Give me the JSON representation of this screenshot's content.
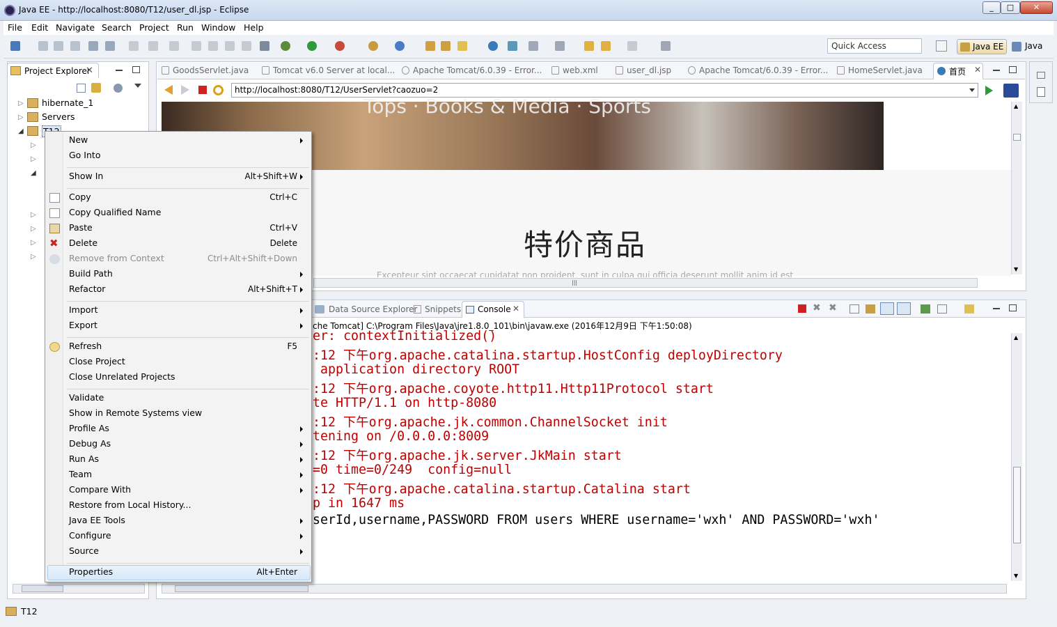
{
  "window": {
    "title": "Java EE - http://localhost:8080/T12/user_dl.jsp - Eclipse"
  },
  "menubar": [
    "File",
    "Edit",
    "Navigate",
    "Search",
    "Project",
    "Run",
    "Window",
    "Help"
  ],
  "toolbar": {
    "quick_access": "Quick Access",
    "perspective_active": "Java EE",
    "perspective_other": "Java"
  },
  "project_explorer": {
    "tab_label": "Project Explorer",
    "items": [
      {
        "label": "hibernate_1"
      },
      {
        "label": "Servers"
      },
      {
        "label": "T12"
      }
    ]
  },
  "editor": {
    "tabs": [
      {
        "label": "GoodsServlet.java"
      },
      {
        "label": "Tomcat v6.0 Server at local..."
      },
      {
        "label": "Apache Tomcat/6.0.39 - Error..."
      },
      {
        "label": "web.xml"
      },
      {
        "label": "user_dl.jsp"
      },
      {
        "label": "Apache Tomcat/6.0.39 - Error..."
      },
      {
        "label": "HomeServlet.java"
      },
      {
        "label": "首页"
      }
    ],
    "url": "http://localhost:8080/T12/UserServlet?caozuo=2",
    "web": {
      "banner_text": "Tops · Books & Media · Sports",
      "heading": "特价商品",
      "subtext": "Excepteur sint occaecat cupidatat non proident, sunt in culpa qui officia deserunt mollit anim id est"
    }
  },
  "console": {
    "tabs": [
      {
        "label": "Data Source Explorer"
      },
      {
        "label": "Snippets"
      },
      {
        "label": "Console"
      }
    ],
    "header": "che Tomcat] C:\\Program Files\\Java\\jre1.8.0_101\\bin\\javaw.exe (2016年12月9日 下午1:50:08)",
    "lines": [
      "er: contextInitialized()",
      ":12 下午org.apache.catalina.startup.HostConfig deployDirectory",
      " application directory ROOT",
      ":12 下午org.apache.coyote.http11.Http11Protocol start",
      "te HTTP/1.1 on http-8080",
      ":12 下午org.apache.jk.common.ChannelSocket init",
      "tening on /0.0.0.0:8009",
      ":12 下午org.apache.jk.server.JkMain start",
      "=0 time=0/249  config=null",
      ":12 下午org.apache.catalina.startup.Catalina start",
      "p in 1647 ms",
      "serId,username,PASSWORD FROM users WHERE username='wxh' AND PASSWORD='wxh'"
    ]
  },
  "context_menu": {
    "items": [
      {
        "label": "New",
        "shortcut": "",
        "submenu": true
      },
      {
        "label": "Go Into",
        "shortcut": ""
      },
      {
        "label": "Show In",
        "shortcut": "Alt+Shift+W",
        "submenu": true
      },
      {
        "label": "Copy",
        "shortcut": "Ctrl+C"
      },
      {
        "label": "Copy Qualified Name",
        "shortcut": ""
      },
      {
        "label": "Paste",
        "shortcut": "Ctrl+V"
      },
      {
        "label": "Delete",
        "shortcut": "Delete"
      },
      {
        "label": "Remove from Context",
        "shortcut": "Ctrl+Alt+Shift+Down",
        "disabled": true
      },
      {
        "label": "Build Path",
        "shortcut": "",
        "submenu": true
      },
      {
        "label": "Refactor",
        "shortcut": "Alt+Shift+T",
        "submenu": true
      },
      {
        "label": "Import",
        "shortcut": "",
        "submenu": true
      },
      {
        "label": "Export",
        "shortcut": "",
        "submenu": true
      },
      {
        "label": "Refresh",
        "shortcut": "F5"
      },
      {
        "label": "Close Project",
        "shortcut": ""
      },
      {
        "label": "Close Unrelated Projects",
        "shortcut": ""
      },
      {
        "label": "Validate",
        "shortcut": ""
      },
      {
        "label": "Show in Remote Systems view",
        "shortcut": ""
      },
      {
        "label": "Profile As",
        "shortcut": "",
        "submenu": true
      },
      {
        "label": "Debug As",
        "shortcut": "",
        "submenu": true
      },
      {
        "label": "Run As",
        "shortcut": "",
        "submenu": true
      },
      {
        "label": "Team",
        "shortcut": "",
        "submenu": true
      },
      {
        "label": "Compare With",
        "shortcut": "",
        "submenu": true
      },
      {
        "label": "Restore from Local History...",
        "shortcut": ""
      },
      {
        "label": "Java EE Tools",
        "shortcut": "",
        "submenu": true
      },
      {
        "label": "Configure",
        "shortcut": "",
        "submenu": true
      },
      {
        "label": "Source",
        "shortcut": "",
        "submenu": true
      },
      {
        "label": "Properties",
        "shortcut": "Alt+Enter",
        "highlighted": true
      }
    ]
  },
  "statusbar": {
    "selection": "T12"
  }
}
